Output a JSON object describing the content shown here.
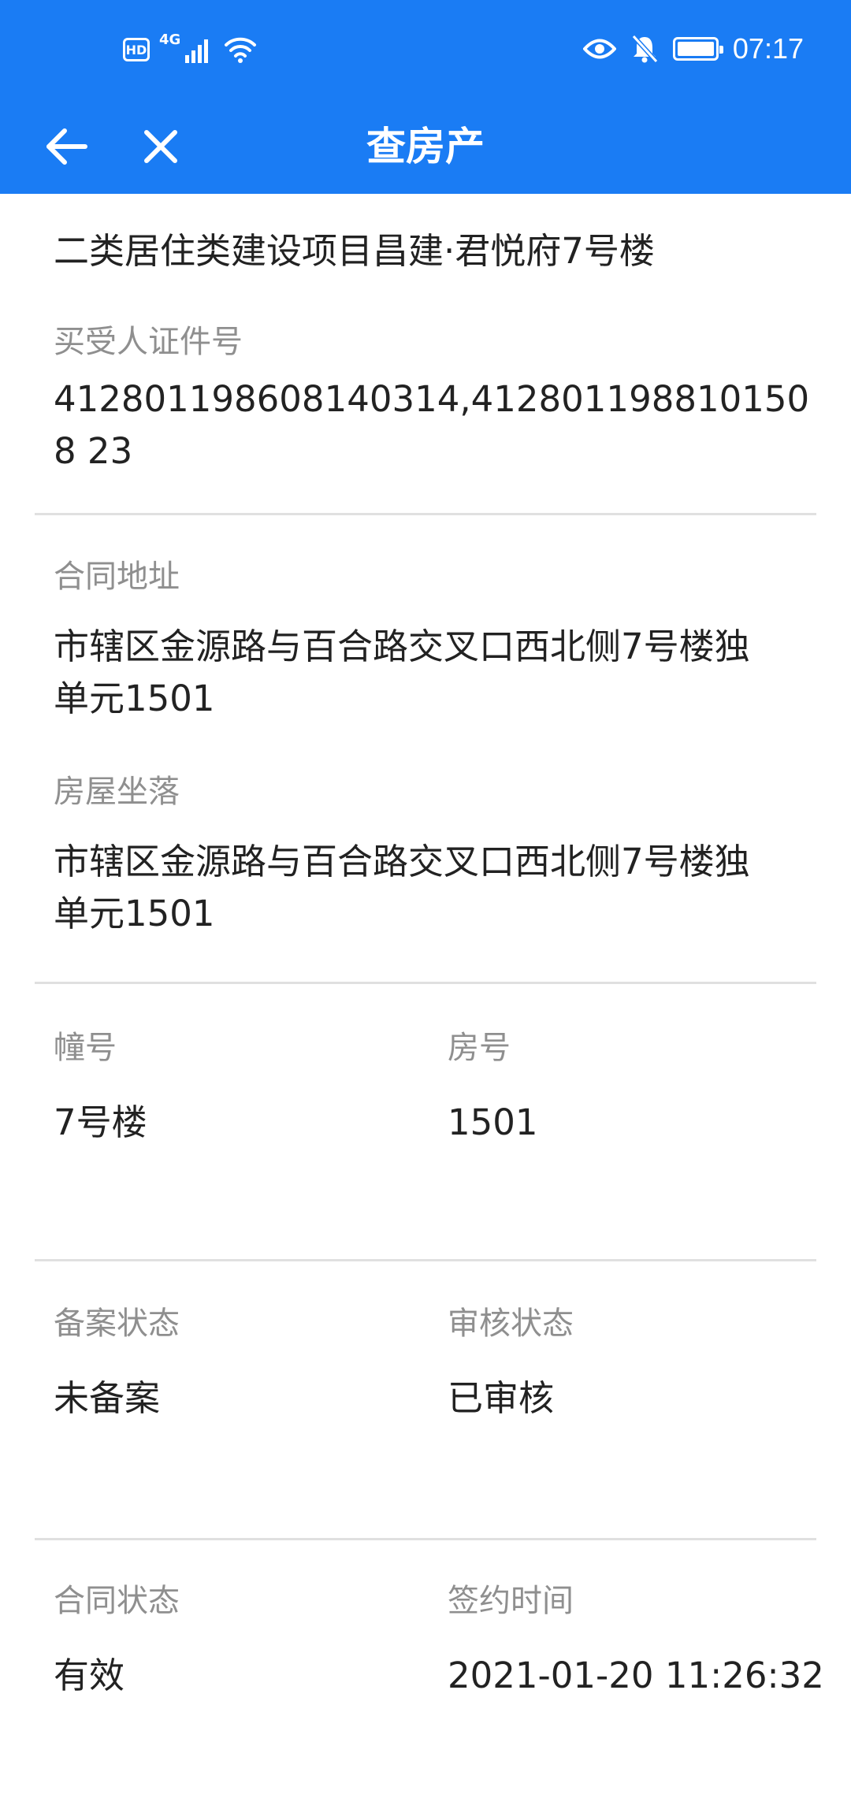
{
  "status_bar": {
    "hd_badge": "HD",
    "network_type": "4G",
    "time": "07:17"
  },
  "nav": {
    "title": "查房产"
  },
  "project": {
    "value": "二类居住类建设项目昌建·君悦府7号楼"
  },
  "buyer_id": {
    "label": "买受人证件号",
    "value": "412801198608140314,4128011988101508 23"
  },
  "contract_address": {
    "label": "合同地址",
    "value_line1": "市辖区金源路与百合路交叉口西北侧7号楼独",
    "value_line2": "单元1501"
  },
  "property_location": {
    "label": "房屋坐落",
    "value_line1": "市辖区金源路与百合路交叉口西北侧7号楼独",
    "value_line2": "单元1501"
  },
  "building": {
    "label": "幢号",
    "value": "7号楼"
  },
  "room": {
    "label": "房号",
    "value": "1501"
  },
  "filing_status": {
    "label": "备案状态",
    "value": "未备案"
  },
  "review_status": {
    "label": "审核状态",
    "value": "已审核"
  },
  "contract_status": {
    "label": "合同状态",
    "value": "有效"
  },
  "sign_time": {
    "label": "签约时间",
    "value": "2021-01-20 11:26:32"
  },
  "colors": {
    "primary": "#1a7cf4",
    "label": "#8f8f8f",
    "text": "#222222",
    "divider": "#e0e0e0"
  }
}
